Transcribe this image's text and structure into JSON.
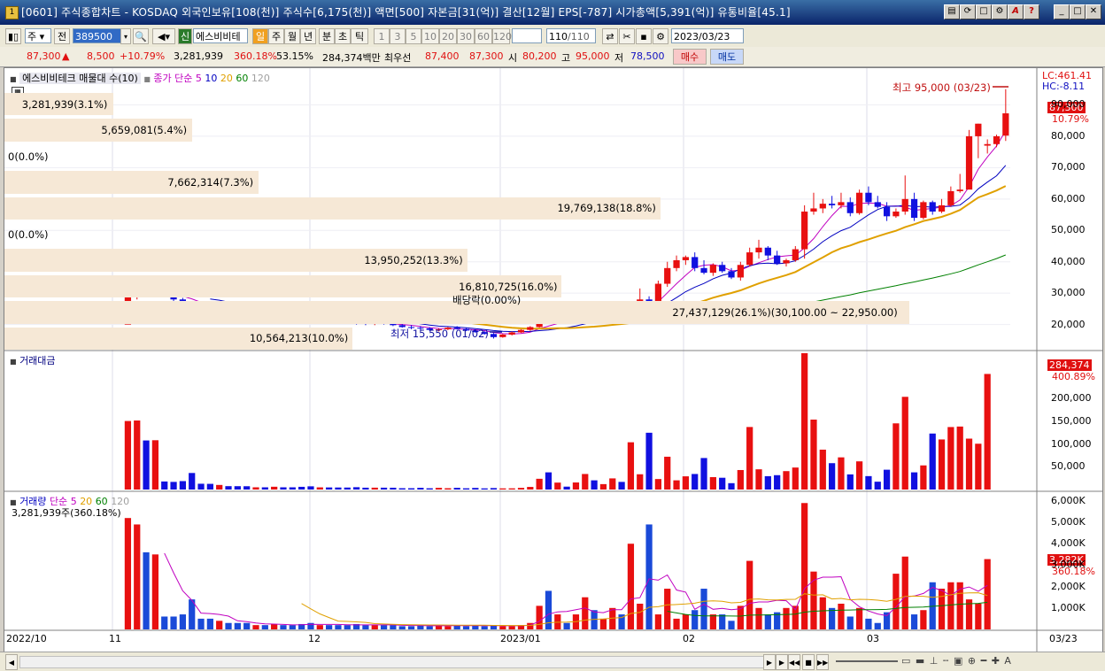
{
  "window": {
    "title": "[0601] 주식종합차트 - KOSDAQ 외국인보유[108(천)] 주식수[6,175(천)] 액면[500] 자본금[31(억)] 결산[12월] EPS[-787] 시가총액[5,391(억)] 유통비율[45.1]",
    "icon": "chart-app-icon",
    "controls": [
      "layout-icon",
      "refresh-icon",
      "window-icon",
      "settings-icon",
      "font-icon",
      "help-icon",
      "minimize-icon",
      "maximize-icon",
      "close-icon"
    ]
  },
  "toolbar": {
    "market_select": "주",
    "prev_label": "전",
    "code": "389500",
    "stock_name": "에스비비테",
    "new_label": "신",
    "period_tabs": [
      "일",
      "주",
      "월",
      "년",
      "분",
      "초",
      "틱"
    ],
    "active_period": "일",
    "intervals": [
      "1",
      "3",
      "5",
      "10",
      "20",
      "30",
      "60",
      "120"
    ],
    "count": "110",
    "count_total": "/110",
    "date": "2023/03/23"
  },
  "quote": {
    "price": "87,300",
    "change": "8,500",
    "change_pct": "+10.79%",
    "volume": "3,281,939",
    "volume_ratio": "360.18%",
    "rate": "53.15%",
    "amount": "284,374백만",
    "best_label": "최우선",
    "ask": "87,400",
    "bid": "87,300",
    "open_label": "시",
    "open": "80,200",
    "high_label": "고",
    "high": "95,000",
    "low_label": "저",
    "low": "78,500",
    "buy_label": "매수",
    "sell_label": "매도"
  },
  "price_pane": {
    "series_label": "에스비비테크 매물대 수(10)",
    "ma_label": "종가 단순",
    "ma_periods": [
      "5",
      "10",
      "20",
      "60",
      "120"
    ],
    "ma_colors": [
      "#c000c0",
      "#0000c0",
      "#e0a000",
      "#008000",
      "#a0a0a0"
    ],
    "lc_label": "LC:461.41",
    "hc_label": "HC:-8.11",
    "current_price": "87,300",
    "current_pct": "10.79%",
    "high_note": "최고 95,000 (03/23)",
    "low_note": "최저 15,550 (01/02)",
    "dividend_note": "배당락(0.00%)",
    "y_labels": [
      "90,000",
      "80,000",
      "70,000",
      "60,000",
      "50,000",
      "40,000",
      "30,000",
      "20,000"
    ],
    "volume_profile": [
      {
        "text": "3,281,939(3.1%)",
        "w": 0.108
      },
      {
        "text": "5,659,081(5.4%)",
        "w": 0.187
      },
      {
        "text": "0(0.0%)",
        "w": 0
      },
      {
        "text": "7,662,314(7.3%)",
        "w": 0.253
      },
      {
        "text": "19,769,138(18.8%)",
        "w": 0.652
      },
      {
        "text": "0(0.0%)",
        "w": 0
      },
      {
        "text": "13,950,252(13.3%)",
        "w": 0.46
      },
      {
        "text": "16,810,725(16.0%)",
        "w": 0.554
      },
      {
        "text": "27,437,129(26.1%)(30,100.00 ~ 22,950.00)",
        "w": 0.9
      },
      {
        "text": "10,564,213(10.0%)",
        "w": 0.346
      }
    ]
  },
  "amount_pane": {
    "title": "거래대금",
    "current": "284,374",
    "current_pct": "400.89%",
    "y_labels": [
      "200,000",
      "150,000",
      "100,000",
      "50,000"
    ]
  },
  "volume_pane": {
    "title": "거래량",
    "ma_label": "단순",
    "ma_periods": [
      "5",
      "20",
      "60",
      "120"
    ],
    "info": "3,281,939주(360.18%)",
    "current": "3,282K",
    "current_pct": "360.18%",
    "y_labels": [
      "6,000K",
      "5,000K",
      "4,000K",
      "3,000K",
      "2,000K",
      "1,000K"
    ]
  },
  "x_axis": {
    "labels": [
      "2022/10",
      "11",
      "12",
      "2023/01",
      "02",
      "03"
    ],
    "last_date": "03/23"
  },
  "chart_data": {
    "type": "candlestick",
    "title": "에스비비테크 매물대 수(10)",
    "ylim": [
      12000,
      100000
    ],
    "candles": [
      [
        20000,
        30000,
        21000,
        29000
      ],
      [
        29500,
        33500,
        28000,
        31000
      ],
      [
        30500,
        32000,
        29000,
        30000
      ],
      [
        30000,
        32000,
        29000,
        31000
      ],
      [
        31000,
        31500,
        29000,
        29500
      ],
      [
        29500,
        30000,
        27500,
        28000
      ],
      [
        28000,
        28500,
        26000,
        26500
      ],
      [
        26500,
        27000,
        25500,
        26000
      ],
      [
        26000,
        26500,
        25000,
        25500
      ],
      [
        25500,
        26000,
        24500,
        25000
      ],
      [
        25000,
        25500,
        24500,
        25200
      ],
      [
        25200,
        25500,
        24500,
        24800
      ],
      [
        24800,
        25200,
        24300,
        24600
      ],
      [
        24600,
        25000,
        24000,
        24200
      ],
      [
        24200,
        24800,
        23800,
        24500
      ],
      [
        24500,
        25000,
        24000,
        24300
      ],
      [
        24300,
        24800,
        24000,
        24600
      ],
      [
        24600,
        25000,
        24200,
        24400
      ],
      [
        24400,
        24800,
        24000,
        24300
      ],
      [
        24300,
        24600,
        23500,
        23800
      ],
      [
        23800,
        24200,
        23300,
        23500
      ],
      [
        23500,
        24000,
        23000,
        23800
      ],
      [
        23800,
        24200,
        22800,
        23000
      ],
      [
        23000,
        23500,
        22000,
        22300
      ],
      [
        22300,
        22800,
        21500,
        21800
      ],
      [
        21800,
        22500,
        20000,
        20500
      ],
      [
        20500,
        21000,
        19800,
        20200
      ],
      [
        20200,
        20800,
        19800,
        20500
      ],
      [
        20500,
        21000,
        20000,
        20300
      ],
      [
        20300,
        20800,
        19500,
        19800
      ],
      [
        19800,
        20300,
        19000,
        19200
      ],
      [
        19200,
        19800,
        18500,
        19000
      ],
      [
        19000,
        19500,
        18300,
        18800
      ],
      [
        18800,
        19200,
        18000,
        18300
      ],
      [
        18300,
        18800,
        17800,
        18500
      ],
      [
        18500,
        19200,
        18200,
        19000
      ],
      [
        19000,
        19500,
        18400,
        18600
      ],
      [
        18600,
        18900,
        17900,
        18100
      ],
      [
        18100,
        18500,
        17300,
        17600
      ],
      [
        17600,
        18000,
        16800,
        17000
      ],
      [
        17000,
        17300,
        15550,
        16000
      ],
      [
        16000,
        17000,
        15800,
        16800
      ],
      [
        16800,
        17800,
        16500,
        17500
      ],
      [
        17500,
        18500,
        17300,
        18300
      ],
      [
        18300,
        19500,
        18000,
        19200
      ],
      [
        19200,
        22000,
        19000,
        21500
      ],
      [
        21500,
        22500,
        20500,
        21000
      ],
      [
        21000,
        22000,
        20500,
        21800
      ],
      [
        21800,
        22500,
        21000,
        21200
      ],
      [
        21200,
        22500,
        21000,
        22200
      ],
      [
        22200,
        23200,
        21800,
        22800
      ],
      [
        22800,
        23500,
        22200,
        22500
      ],
      [
        22500,
        24000,
        22300,
        23800
      ],
      [
        23800,
        25000,
        23500,
        24500
      ],
      [
        24500,
        25500,
        23800,
        24000
      ],
      [
        24000,
        26500,
        23800,
        26000
      ],
      [
        26000,
        31500,
        25500,
        28000
      ],
      [
        28000,
        29000,
        24500,
        25500
      ],
      [
        25500,
        34000,
        25000,
        33000
      ],
      [
        33000,
        40000,
        32000,
        38000
      ],
      [
        38000,
        42000,
        37000,
        40500
      ],
      [
        40500,
        42000,
        39000,
        41500
      ],
      [
        41500,
        43000,
        37000,
        38000
      ],
      [
        38000,
        40500,
        36000,
        36500
      ],
      [
        36500,
        39500,
        35500,
        39000
      ],
      [
        39000,
        40000,
        36500,
        37000
      ],
      [
        37000,
        38000,
        34500,
        35000
      ],
      [
        35000,
        40000,
        34000,
        39000
      ],
      [
        39000,
        44500,
        38500,
        43000
      ],
      [
        43000,
        47000,
        41000,
        44500
      ],
      [
        44500,
        45000,
        40500,
        42000
      ],
      [
        42000,
        43500,
        39000,
        39500
      ],
      [
        39500,
        41000,
        38500,
        40500
      ],
      [
        40500,
        45000,
        40000,
        44000
      ],
      [
        44000,
        58000,
        41000,
        56000
      ],
      [
        56000,
        62000,
        55000,
        57000
      ],
      [
        57000,
        60000,
        55500,
        58500
      ],
      [
        58500,
        61000,
        57000,
        58000
      ],
      [
        58000,
        62000,
        57000,
        59000
      ],
      [
        59000,
        60500,
        54500,
        55500
      ],
      [
        55500,
        63000,
        55000,
        62000
      ],
      [
        62000,
        64000,
        58000,
        59000
      ],
      [
        59000,
        61000,
        57000,
        57500
      ],
      [
        57500,
        59000,
        53000,
        54500
      ],
      [
        54500,
        57000,
        54000,
        56000
      ],
      [
        56000,
        67500,
        55000,
        60000
      ],
      [
        60000,
        62000,
        53000,
        54000
      ],
      [
        54000,
        59500,
        53500,
        59000
      ],
      [
        59000,
        59500,
        55000,
        56000
      ],
      [
        56000,
        60000,
        55500,
        58000
      ],
      [
        58000,
        64000,
        57500,
        62500
      ],
      [
        62500,
        68000,
        62000,
        63000
      ],
      [
        63000,
        82000,
        72000,
        80000
      ],
      [
        80000,
        84000,
        73000,
        84000
      ],
      [
        77000,
        79000,
        74500,
        77500
      ],
      [
        77500,
        80500,
        76500,
        80000
      ],
      [
        80200,
        95000,
        78500,
        87300
      ]
    ],
    "volume_k": [
      5200,
      4900,
      3600,
      3500,
      600,
      600,
      700,
      1400,
      500,
      500,
      400,
      300,
      300,
      300,
      200,
      200,
      250,
      200,
      200,
      250,
      300,
      200,
      200,
      200,
      200,
      250,
      200,
      200,
      200,
      200,
      150,
      150,
      200,
      150,
      200,
      150,
      200,
      150,
      200,
      150,
      200,
      150,
      150,
      200,
      300,
      1100,
      1800,
      700,
      300,
      700,
      1500,
      900,
      500,
      1000,
      700,
      4000,
      1200,
      4900,
      700,
      1900,
      500,
      700,
      900,
      1900,
      700,
      700,
      400,
      1100,
      3200,
      1000,
      700,
      800,
      1000,
      1100,
      5900,
      2700,
      1500,
      1000,
      1200,
      600,
      1000,
      500,
      300,
      800,
      2600,
      3400,
      700,
      900,
      2200,
      1900,
      2200,
      2200,
      1400,
      1200,
      3282
    ],
    "x_labels": [
      "2022/10",
      "11",
      "12",
      "2023/01",
      "02",
      "03"
    ]
  }
}
